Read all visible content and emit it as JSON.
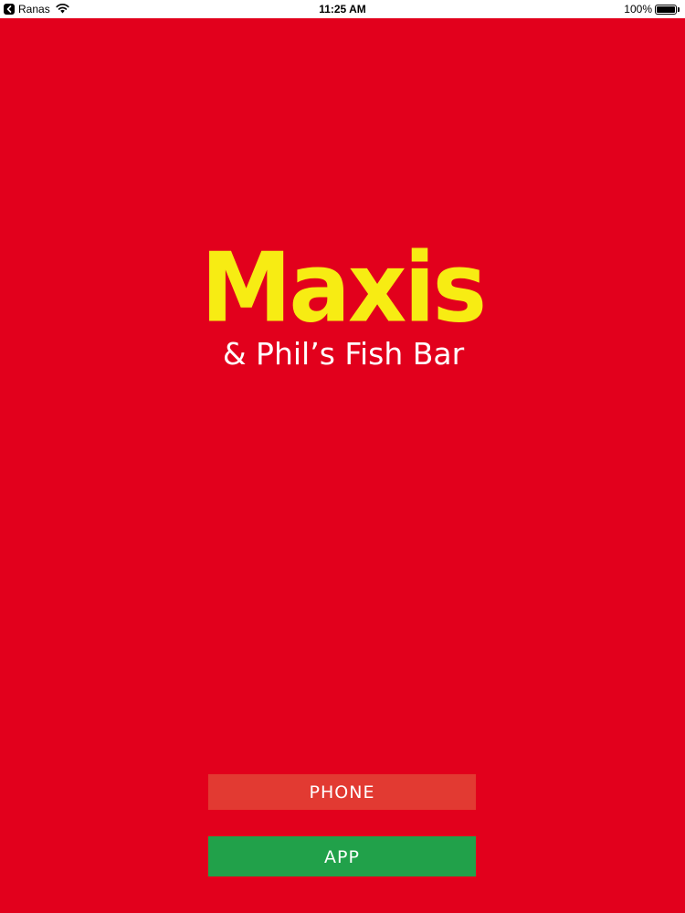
{
  "status_bar": {
    "back_app": "Ranas",
    "time": "11:25 AM",
    "battery": "100%",
    "back_icon": "back-chevron-icon",
    "wifi_icon": "wifi-icon",
    "battery_icon": "battery-full-icon",
    "battery_level": 1.0
  },
  "logo": {
    "main": "Maxis",
    "sub": "& Phil’s Fish Bar",
    "main_color": "#f7ec13",
    "sub_color": "#ffffff"
  },
  "buttons": {
    "phone": "PHONE",
    "app": "APP"
  },
  "colors": {
    "background": "#e2001c",
    "phone_button": "#e23a32",
    "app_button": "#21a14a"
  }
}
